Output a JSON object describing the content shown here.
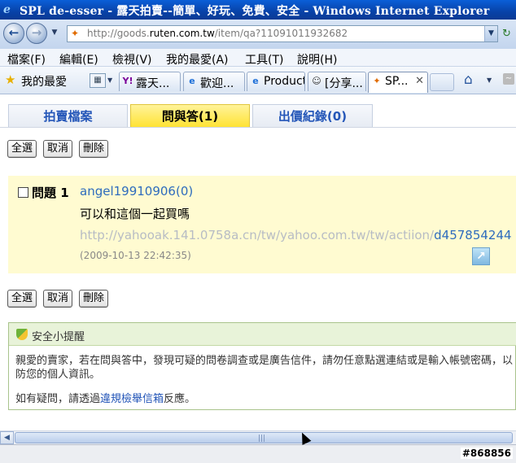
{
  "window": {
    "title": "SPL de-esser - 露天拍賣--簡單、好玩、免費、安全 - Windows Internet Explorer",
    "app_icon": "ie-logo-icon"
  },
  "address_bar": {
    "url_prefix": "http://goods.",
    "url_domain": "ruten.com.tw",
    "url_suffix": "/item/qa?11091011932682"
  },
  "menu": [
    "檔案(F)",
    "編輯(E)",
    "檢視(V)",
    "我的最愛(A)",
    "工具(T)",
    "說明(H)"
  ],
  "favorites": {
    "label": "我的最愛"
  },
  "browser_tabs": [
    {
      "label": "露天...",
      "icon": "yahoo-icon"
    },
    {
      "label": "歡迎...",
      "icon": "ie-page-icon"
    },
    {
      "label": "Product",
      "icon": "ie-page-icon"
    },
    {
      "label": "[分享...",
      "icon": "forum-icon"
    },
    {
      "label": "SP...",
      "icon": "ruten-icon",
      "active": true
    }
  ],
  "page_tabs": [
    {
      "label": "拍賣檔案",
      "active": false
    },
    {
      "label": "問與答(1)",
      "active": true
    },
    {
      "label": "出價紀錄(0)",
      "active": false
    }
  ],
  "actions": {
    "select_all": "全選",
    "cancel": "取消",
    "delete": "刪除"
  },
  "question": {
    "label": "問題 1",
    "user": "angel19910906(0)",
    "text": "可以和這個一起買嗎",
    "link_gray": "http://yahooak.141.0758a.cn/tw/yahoo.com.tw/tw/actiion/",
    "link_blue": "d457854244",
    "time": "(2009-10-13 22:42:35)"
  },
  "safety": {
    "title": "安全小提醒",
    "body": "親愛的賣家，若在問與答中，發現可疑的問卷調查或是廣告信件，請勿任意點選連結或是輸入帳號密碼，以防您的個人資訊。",
    "p2_before": "如有疑問，請透過",
    "p2_link": "違規檢舉信箱",
    "p2_after": "反應。"
  },
  "status": {
    "code": "#868856"
  }
}
